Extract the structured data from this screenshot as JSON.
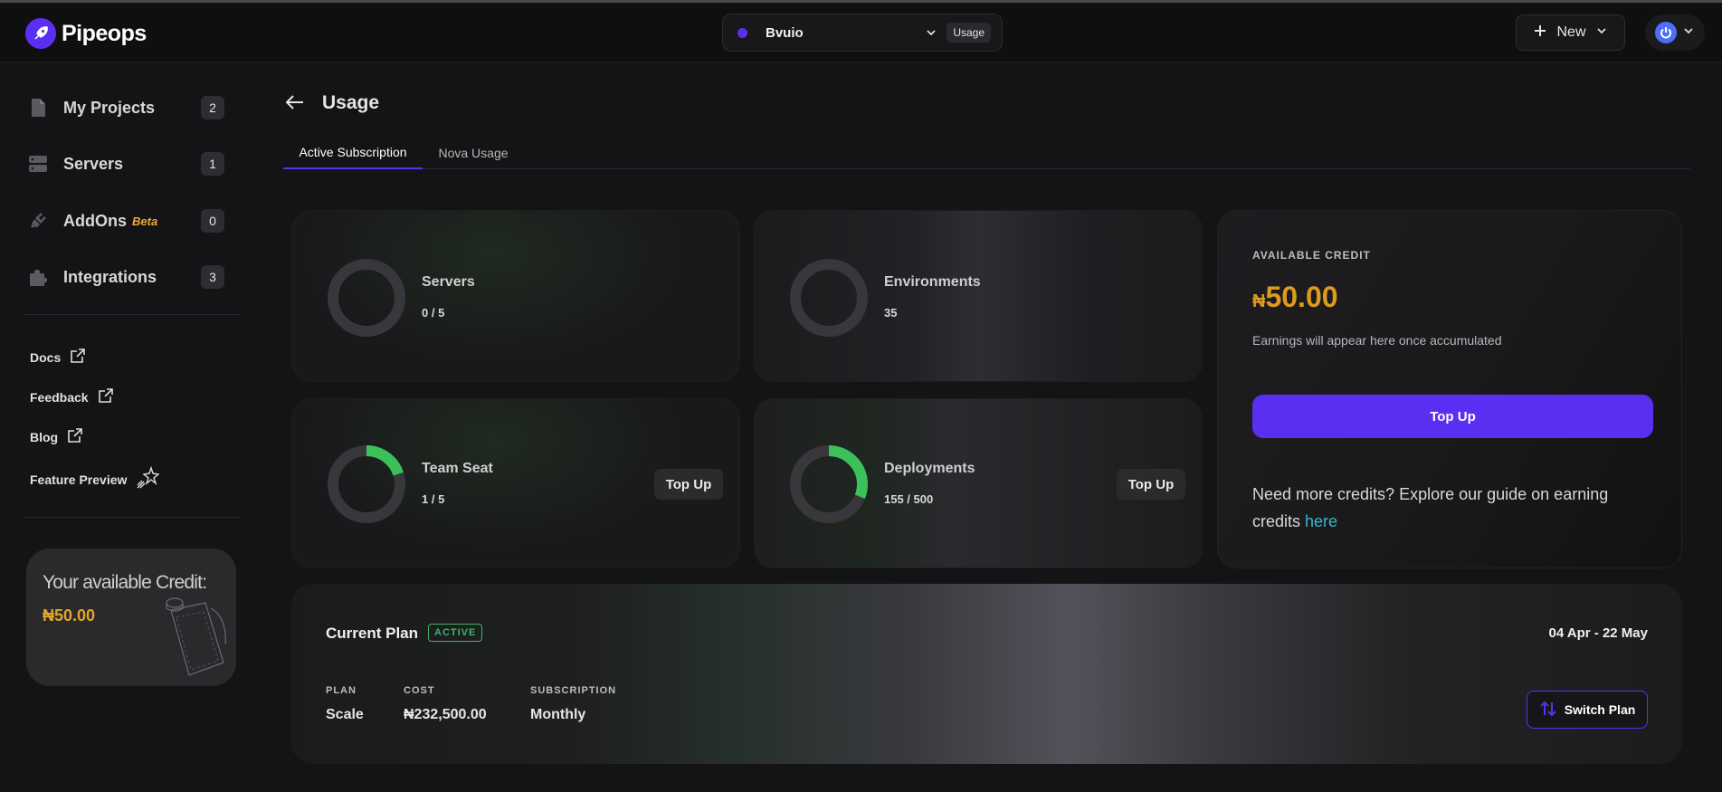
{
  "header": {
    "brand": "Pipeops",
    "workspace": {
      "name": "Bvuio",
      "badge": "Usage"
    },
    "new_label": "New"
  },
  "sidebar": {
    "nav": [
      {
        "label": "My Projects",
        "count": "2",
        "icon": "document-icon"
      },
      {
        "label": "Servers",
        "count": "1",
        "icon": "server-icon"
      },
      {
        "label": "AddOns",
        "badge": "Beta",
        "count": "0",
        "icon": "plug-icon"
      },
      {
        "label": "Integrations",
        "count": "3",
        "icon": "puzzle-icon"
      }
    ],
    "links": [
      {
        "label": "Docs",
        "icon": "external-link-icon"
      },
      {
        "label": "Feedback",
        "icon": "external-link-icon"
      },
      {
        "label": "Blog",
        "icon": "external-link-icon"
      },
      {
        "label": "Feature Preview",
        "icon": "sparkle-icon"
      }
    ],
    "credit_card": {
      "title": "Your available Credit:",
      "amount": "₦50.00"
    }
  },
  "page": {
    "title": "Usage",
    "tabs": [
      {
        "label": "Active Subscription",
        "active": true
      },
      {
        "label": "Nova Usage",
        "active": false
      }
    ]
  },
  "stats": [
    {
      "label": "Servers",
      "value": "0 / 5",
      "fraction": 0
    },
    {
      "label": "Environments",
      "value": "35",
      "fraction": 0
    },
    {
      "label": "Team Seat",
      "value": "1 / 5",
      "fraction": 0.2,
      "action": "Top Up"
    },
    {
      "label": "Deployments",
      "value": "155 / 500",
      "fraction": 0.31,
      "action": "Top Up"
    }
  ],
  "credit_panel": {
    "label": "AVAILABLE CREDIT",
    "currency": "₦",
    "amount": "50.00",
    "note": "Earnings will appear here once accumulated",
    "topup_label": "Top Up",
    "more_text": "Need more credits? Explore our guide on earning credits ",
    "more_link": "here"
  },
  "plan": {
    "title": "Current Plan",
    "status": "ACTIVE",
    "dates": "04 Apr - 22 May",
    "columns": [
      {
        "label": "PLAN",
        "value": "Scale"
      },
      {
        "label": "COST",
        "value": "₦232,500.00"
      },
      {
        "label": "SUBSCRIPTION",
        "value": "Monthly"
      }
    ],
    "switch_label": "Switch Plan"
  },
  "colors": {
    "accent": "#5b2ff2",
    "progress": "#3bc05a",
    "credit": "#e09a1c",
    "active_badge": "#3bb86a"
  }
}
